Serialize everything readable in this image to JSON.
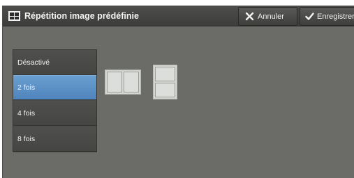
{
  "window": {
    "title": "Répétition image prédéfinie"
  },
  "toolbar": {
    "cancel_label": "Annuler",
    "save_label": "Enregistrer"
  },
  "options": {
    "items": [
      {
        "label": "Désactivé"
      },
      {
        "label": "2 fois"
      },
      {
        "label": "4 fois"
      },
      {
        "label": "8 fois"
      }
    ],
    "selected": "2 fois"
  },
  "patterns": [
    {
      "icon": "two-side-by-side-icon"
    },
    {
      "icon": "two-stacked-icon"
    }
  ],
  "colors": {
    "background": "#6b6c68",
    "titlebar": "#444442",
    "menu": "#4a4b48",
    "selected": "#5b91c8"
  }
}
